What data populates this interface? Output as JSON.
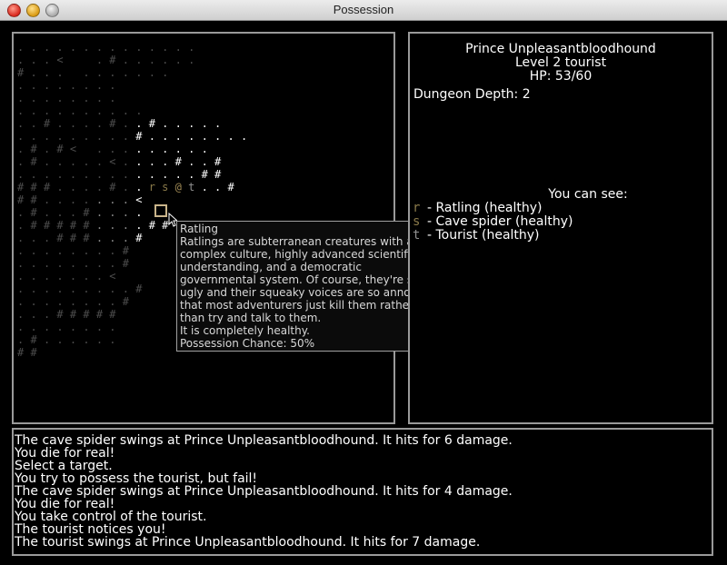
{
  "window": {
    "title": "Possession"
  },
  "map": {
    "rows": [
      ". . . . . . . . . . . . . .",
      ". . . <     . # . . . . . .",
      "# . . .   . . . . . . .",
      ". . . . . . . .",
      ". . . . . . . .",
      ". . . . . . . . . .",
      ". . # . . . . # . . # . . . . .",
      ". . . . . . . . . # . . . . . . . .",
      ". # . # <   . . . . . . . . .",
      ". # . . . . . < . . . . # . . #",
      ". . . . . . . . . . . . . . # #",
      "# # # . . . . # . . r s @ t . . #",
      "# # . . . . . . . <",
      ". # . . . # . . . .",
      ". # # # # # . . . . # #",
      ". . . # # # . . . #",
      ". . . . . . . . #",
      ". . . . . . . . #",
      ". . . . . . . <",
      ". . . . . . . . . #",
      ". . . . . . . . #",
      ". . . # # # # #",
      ". . . . . . . .",
      ". # . . . . . .",
      "# #"
    ],
    "target": {
      "creature": "r"
    },
    "creatures": {
      "ratling": "r",
      "spider": "s",
      "you": "@",
      "tourist": "t"
    }
  },
  "tooltip": {
    "lines": [
      "Ratling",
      "Ratlings are subterranean creatures with a",
      "complex culture, highly advanced scientific",
      "understanding, and a democratic",
      "governmental system. Of course, they're so",
      "ugly and their squeaky voices are so annoying",
      "that most adventurers just kill them rather",
      "than try and talk to them.",
      "It is completely healthy.",
      "Possession Chance: 50%"
    ]
  },
  "status": {
    "name": "Prince Unpleasantbloodhound",
    "level": "Level 2 tourist",
    "hp": "HP: 53/60",
    "depth": "Dungeon Depth: 2",
    "you_can_see": "You can see:",
    "seen": [
      {
        "glyph": "r",
        "text": "- Ratling (healthy)"
      },
      {
        "glyph": "s",
        "text": "- Cave spider (healthy)"
      },
      {
        "glyph": "t",
        "text": "- Tourist (healthy)"
      }
    ]
  },
  "log": {
    "lines": [
      "The cave spider swings at Prince Unpleasantbloodhound. It hits for 6 damage.",
      "You die for real!",
      "Select a target.",
      "You try to possess the tourist, but fail!",
      "The cave spider swings at Prince Unpleasantbloodhound. It hits for 4 damage.",
      "You die for real!",
      "You take control of the tourist.",
      "The tourist notices you!",
      "The tourist swings at Prince Unpleasantbloodhound. It hits for 7 damage."
    ]
  },
  "colors": {
    "border": "#9a9a9a",
    "cursor": "#c9b48a",
    "ratling": "#8a7a4a",
    "you": "#a08a55"
  }
}
